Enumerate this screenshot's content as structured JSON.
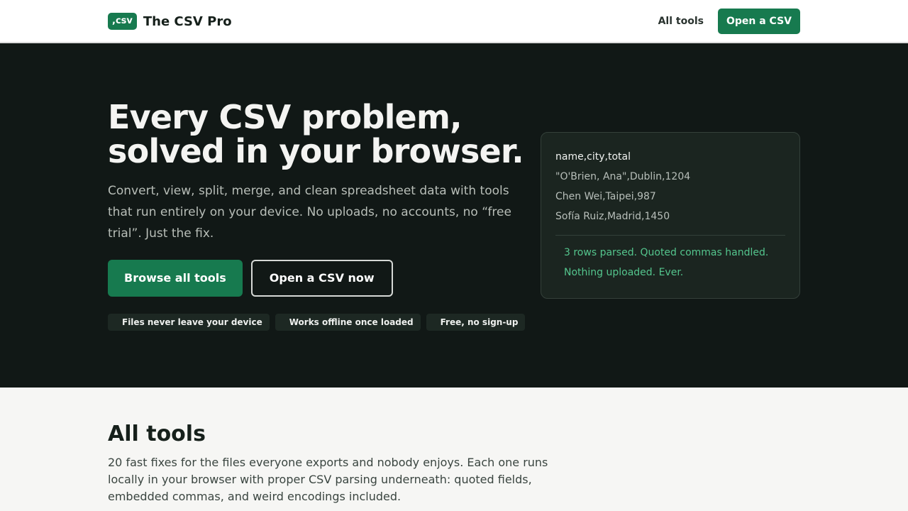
{
  "header": {
    "logo_text": ",csv",
    "brand_name": "The CSV Pro",
    "nav_all_tools": "All tools",
    "nav_cta": "Open a CSV"
  },
  "hero": {
    "title_line1": "Every CSV problem,",
    "title_line2": "solved in your browser.",
    "subtitle": "Convert, view, split, merge, and clean spreadsheet data with tools that run entirely on your device. No uploads, no accounts, no “free trial”. Just the fix.",
    "primary_button": "Browse all tools",
    "secondary_button": "Open a CSV now",
    "badges": [
      "Files never leave your device",
      "Works offline once loaded",
      "Free, no sign-up"
    ]
  },
  "preview": {
    "csv_lines": [
      "name,city,total",
      "\"O'Brien, Ana\",Dublin,1204",
      "Chen Wei,Taipei,987",
      "Sofía Ruiz,Madrid,1450"
    ],
    "result_lines": [
      "3 rows parsed. Quoted commas handled.",
      "Nothing uploaded. Ever."
    ]
  },
  "tools": {
    "title": "All tools",
    "description": "20 fast fixes for the files everyone exports and nobody enjoys. Each one runs locally in your browser with proper CSV parsing underneath: quoted fields, embedded commas, and weird encodings included."
  },
  "colors": {
    "accent": "#177a4f",
    "hero_background": "#111816",
    "success_text": "#54c58d"
  }
}
